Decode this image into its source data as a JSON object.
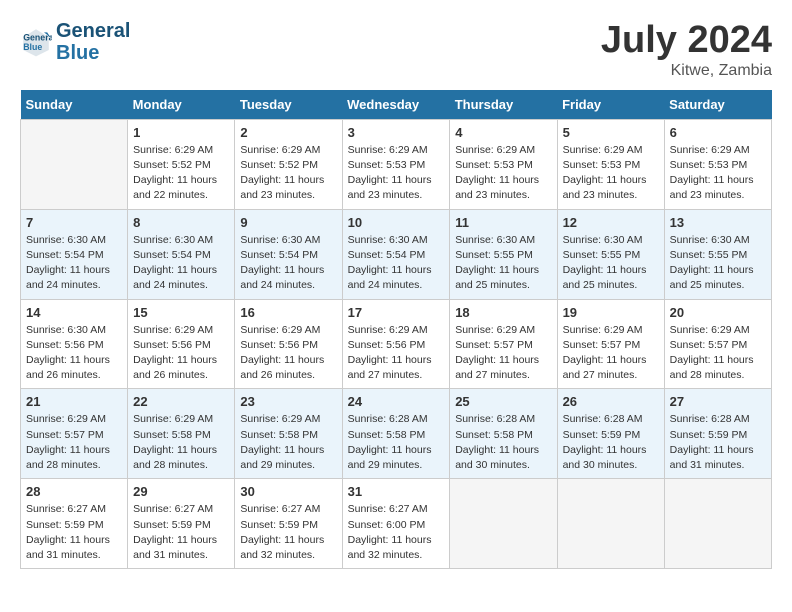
{
  "header": {
    "logo_line1": "General",
    "logo_line2": "Blue",
    "month_title": "July 2024",
    "location": "Kitwe, Zambia"
  },
  "columns": [
    "Sunday",
    "Monday",
    "Tuesday",
    "Wednesday",
    "Thursday",
    "Friday",
    "Saturday"
  ],
  "weeks": [
    [
      {
        "day": "",
        "info": ""
      },
      {
        "day": "1",
        "info": "Sunrise: 6:29 AM\nSunset: 5:52 PM\nDaylight: 11 hours\nand 22 minutes."
      },
      {
        "day": "2",
        "info": "Sunrise: 6:29 AM\nSunset: 5:52 PM\nDaylight: 11 hours\nand 23 minutes."
      },
      {
        "day": "3",
        "info": "Sunrise: 6:29 AM\nSunset: 5:53 PM\nDaylight: 11 hours\nand 23 minutes."
      },
      {
        "day": "4",
        "info": "Sunrise: 6:29 AM\nSunset: 5:53 PM\nDaylight: 11 hours\nand 23 minutes."
      },
      {
        "day": "5",
        "info": "Sunrise: 6:29 AM\nSunset: 5:53 PM\nDaylight: 11 hours\nand 23 minutes."
      },
      {
        "day": "6",
        "info": "Sunrise: 6:29 AM\nSunset: 5:53 PM\nDaylight: 11 hours\nand 23 minutes."
      }
    ],
    [
      {
        "day": "7",
        "info": "Sunrise: 6:30 AM\nSunset: 5:54 PM\nDaylight: 11 hours\nand 24 minutes."
      },
      {
        "day": "8",
        "info": "Sunrise: 6:30 AM\nSunset: 5:54 PM\nDaylight: 11 hours\nand 24 minutes."
      },
      {
        "day": "9",
        "info": "Sunrise: 6:30 AM\nSunset: 5:54 PM\nDaylight: 11 hours\nand 24 minutes."
      },
      {
        "day": "10",
        "info": "Sunrise: 6:30 AM\nSunset: 5:54 PM\nDaylight: 11 hours\nand 24 minutes."
      },
      {
        "day": "11",
        "info": "Sunrise: 6:30 AM\nSunset: 5:55 PM\nDaylight: 11 hours\nand 25 minutes."
      },
      {
        "day": "12",
        "info": "Sunrise: 6:30 AM\nSunset: 5:55 PM\nDaylight: 11 hours\nand 25 minutes."
      },
      {
        "day": "13",
        "info": "Sunrise: 6:30 AM\nSunset: 5:55 PM\nDaylight: 11 hours\nand 25 minutes."
      }
    ],
    [
      {
        "day": "14",
        "info": "Sunrise: 6:30 AM\nSunset: 5:56 PM\nDaylight: 11 hours\nand 26 minutes."
      },
      {
        "day": "15",
        "info": "Sunrise: 6:29 AM\nSunset: 5:56 PM\nDaylight: 11 hours\nand 26 minutes."
      },
      {
        "day": "16",
        "info": "Sunrise: 6:29 AM\nSunset: 5:56 PM\nDaylight: 11 hours\nand 26 minutes."
      },
      {
        "day": "17",
        "info": "Sunrise: 6:29 AM\nSunset: 5:56 PM\nDaylight: 11 hours\nand 27 minutes."
      },
      {
        "day": "18",
        "info": "Sunrise: 6:29 AM\nSunset: 5:57 PM\nDaylight: 11 hours\nand 27 minutes."
      },
      {
        "day": "19",
        "info": "Sunrise: 6:29 AM\nSunset: 5:57 PM\nDaylight: 11 hours\nand 27 minutes."
      },
      {
        "day": "20",
        "info": "Sunrise: 6:29 AM\nSunset: 5:57 PM\nDaylight: 11 hours\nand 28 minutes."
      }
    ],
    [
      {
        "day": "21",
        "info": "Sunrise: 6:29 AM\nSunset: 5:57 PM\nDaylight: 11 hours\nand 28 minutes."
      },
      {
        "day": "22",
        "info": "Sunrise: 6:29 AM\nSunset: 5:58 PM\nDaylight: 11 hours\nand 28 minutes."
      },
      {
        "day": "23",
        "info": "Sunrise: 6:29 AM\nSunset: 5:58 PM\nDaylight: 11 hours\nand 29 minutes."
      },
      {
        "day": "24",
        "info": "Sunrise: 6:28 AM\nSunset: 5:58 PM\nDaylight: 11 hours\nand 29 minutes."
      },
      {
        "day": "25",
        "info": "Sunrise: 6:28 AM\nSunset: 5:58 PM\nDaylight: 11 hours\nand 30 minutes."
      },
      {
        "day": "26",
        "info": "Sunrise: 6:28 AM\nSunset: 5:59 PM\nDaylight: 11 hours\nand 30 minutes."
      },
      {
        "day": "27",
        "info": "Sunrise: 6:28 AM\nSunset: 5:59 PM\nDaylight: 11 hours\nand 31 minutes."
      }
    ],
    [
      {
        "day": "28",
        "info": "Sunrise: 6:27 AM\nSunset: 5:59 PM\nDaylight: 11 hours\nand 31 minutes."
      },
      {
        "day": "29",
        "info": "Sunrise: 6:27 AM\nSunset: 5:59 PM\nDaylight: 11 hours\nand 31 minutes."
      },
      {
        "day": "30",
        "info": "Sunrise: 6:27 AM\nSunset: 5:59 PM\nDaylight: 11 hours\nand 32 minutes."
      },
      {
        "day": "31",
        "info": "Sunrise: 6:27 AM\nSunset: 6:00 PM\nDaylight: 11 hours\nand 32 minutes."
      },
      {
        "day": "",
        "info": ""
      },
      {
        "day": "",
        "info": ""
      },
      {
        "day": "",
        "info": ""
      }
    ]
  ]
}
